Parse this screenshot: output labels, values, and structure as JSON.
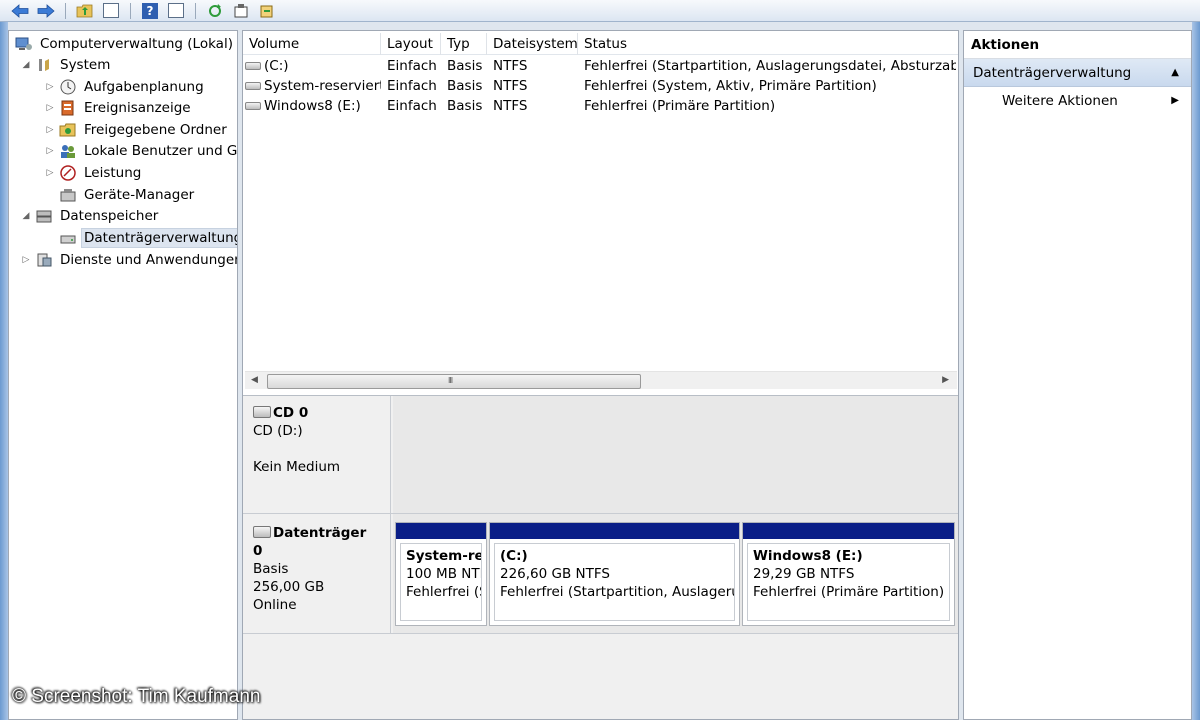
{
  "toolbar": {
    "buttons": [
      "back-icon",
      "forward-icon",
      "up-folder-icon",
      "show-hide-tree-icon",
      "help-icon",
      "show-hide-actions-icon",
      "refresh-icon",
      "properties-icon",
      "export-icon"
    ]
  },
  "tree": {
    "root": "Computerverwaltung (Lokal)",
    "items": [
      {
        "label": "System",
        "level": 1,
        "expander": "expanded"
      },
      {
        "label": "Aufgabenplanung",
        "level": 2,
        "expander": "collapsed"
      },
      {
        "label": "Ereignisanzeige",
        "level": 2,
        "expander": "collapsed"
      },
      {
        "label": "Freigegebene Ordner",
        "level": 2,
        "expander": "collapsed"
      },
      {
        "label": "Lokale Benutzer und Gr",
        "level": 2,
        "expander": "collapsed"
      },
      {
        "label": "Leistung",
        "level": 2,
        "expander": "collapsed"
      },
      {
        "label": "Geräte-Manager",
        "level": 2,
        "expander": "none"
      },
      {
        "label": "Datenspeicher",
        "level": 1,
        "expander": "expanded"
      },
      {
        "label": "Datenträgerverwaltung",
        "level": 2,
        "expander": "none",
        "selected": true
      },
      {
        "label": "Dienste und Anwendungen",
        "level": 1,
        "expander": "collapsed"
      }
    ]
  },
  "volumes": {
    "columns": [
      "Volume",
      "Layout",
      "Typ",
      "Dateisystem",
      "Status"
    ],
    "rows": [
      [
        "(C:)",
        "Einfach",
        "Basis",
        "NTFS",
        "Fehlerfrei (Startpartition, Auslagerungsdatei, Absturzabbild"
      ],
      [
        "System-reserviert",
        "Einfach",
        "Basis",
        "NTFS",
        "Fehlerfrei (System, Aktiv, Primäre Partition)"
      ],
      [
        "Windows8 (E:)",
        "Einfach",
        "Basis",
        "NTFS",
        "Fehlerfrei (Primäre Partition)"
      ]
    ],
    "scroll_grip": "III"
  },
  "disks": {
    "cd": {
      "name": "CD 0",
      "type": "CD (D:)",
      "media": "Kein Medium"
    },
    "disk0": {
      "name": "Datenträger 0",
      "type": "Basis",
      "size": "256,00 GB",
      "state": "Online",
      "partitions": [
        {
          "title": "System-res",
          "size": "100 MB NTF",
          "status": "Fehlerfrei (S"
        },
        {
          "title": "(C:)",
          "size": "226,60 GB NTFS",
          "status": "Fehlerfrei (Startpartition, Auslagerung"
        },
        {
          "title": "Windows8  (E:)",
          "size": "29,29 GB NTFS",
          "status": "Fehlerfrei (Primäre Partition)"
        }
      ],
      "partition_bar_color": "#0a1e87"
    }
  },
  "actions": {
    "title": "Aktionen",
    "section": "Datenträgerverwaltung",
    "items": [
      "Weitere Aktionen"
    ]
  },
  "watermark": "© Screenshot: Tim Kaufmann"
}
